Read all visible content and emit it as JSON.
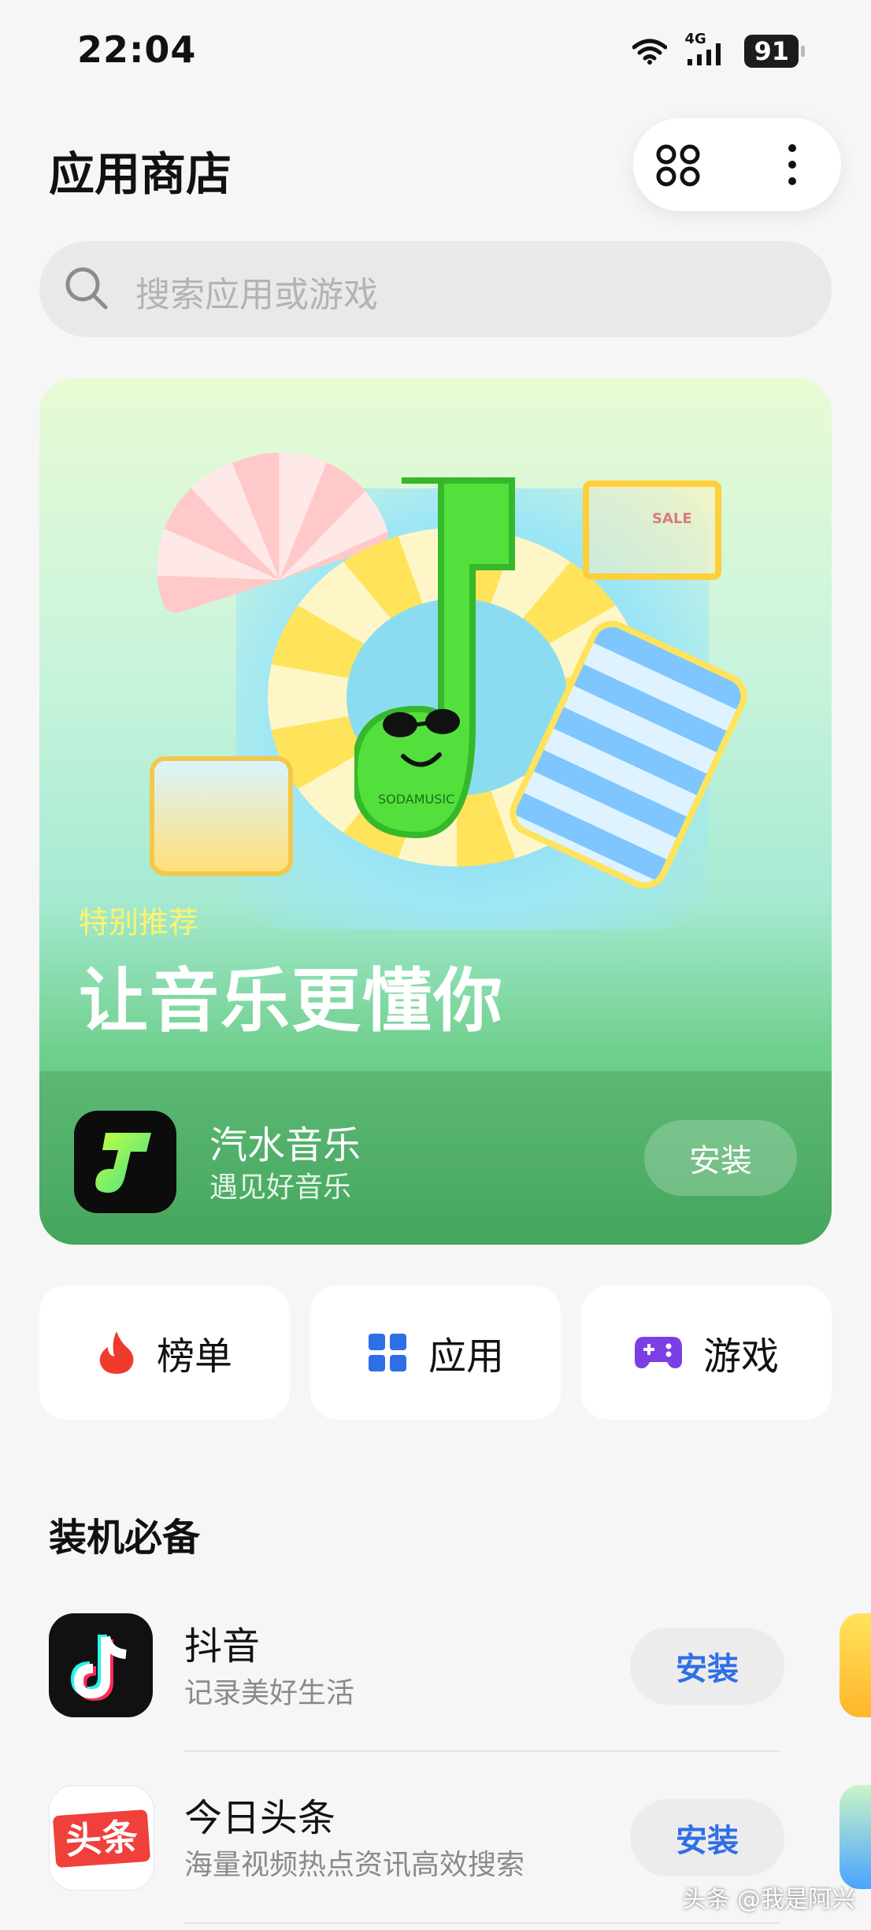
{
  "status_bar": {
    "time": "22:04",
    "network": "4G",
    "battery": "91"
  },
  "header": {
    "title": "应用商店",
    "apps_icon": "four-circles-icon",
    "more_icon": "vertical-dots-icon"
  },
  "search": {
    "placeholder": "搜索应用或游戏"
  },
  "banner": {
    "tag": "特别推荐",
    "headline": "让音乐更懂你",
    "app": {
      "name": "汽水音乐",
      "subtitle": "遇见好音乐",
      "install_label": "安装"
    },
    "art_text": "SODAMUSIC",
    "cart_text": "SALE"
  },
  "categories": [
    {
      "label": "榜单",
      "icon": "flame-icon",
      "color": "#ef3b2c"
    },
    {
      "label": "应用",
      "icon": "grid-icon",
      "color": "#2f6fe6"
    },
    {
      "label": "游戏",
      "icon": "gamepad-icon",
      "color": "#7b3fe4"
    }
  ],
  "essentials": {
    "title": "装机必备",
    "apps": [
      {
        "name": "抖音",
        "desc": "记录美好生活",
        "install_label": "安装",
        "icon": "douyin-icon"
      },
      {
        "name": "今日头条",
        "desc": "海量视频热点资讯高效搜索",
        "install_label": "安装",
        "icon": "toutiao-icon",
        "icon_text": "头条"
      }
    ]
  },
  "watermark": "头条 @我是阿兴",
  "colors": {
    "accent_blue": "#2f6fe6",
    "banner_green": "#4caf64"
  }
}
